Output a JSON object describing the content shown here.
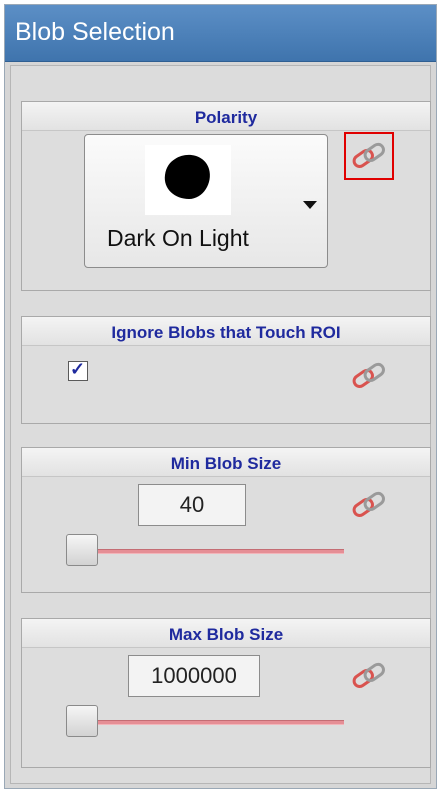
{
  "panel": {
    "title": "Blob Selection"
  },
  "polarity": {
    "title": "Polarity",
    "selected": "Dark On Light",
    "link_icon": "chain-link-icon",
    "highlight_color": "#e00000"
  },
  "ignore_blobs": {
    "title": "Ignore Blobs that Touch ROI",
    "checked": true,
    "check_mark": "✓",
    "link_icon": "chain-link-icon"
  },
  "min_blob_size": {
    "title": "Min Blob Size",
    "value": "40",
    "link_icon": "chain-link-icon"
  },
  "max_blob_size": {
    "title": "Max Blob Size",
    "value": "1000000",
    "link_icon": "chain-link-icon"
  },
  "colors": {
    "header_blue": "#3f74ad",
    "title_text": "#1f2a9e",
    "link_red": "#d9534f",
    "slider_red": "#e58e95"
  }
}
